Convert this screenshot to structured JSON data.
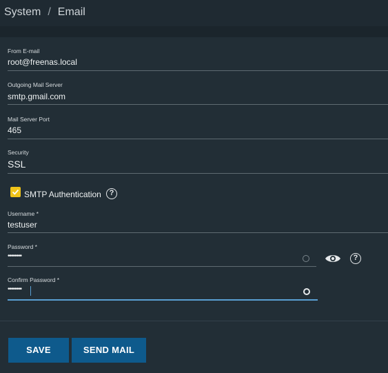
{
  "breadcrumb": {
    "parent": "System",
    "separator": "/",
    "current": "Email"
  },
  "fields": {
    "from_email": {
      "label": "From E-mail",
      "value": "root@freenas.local"
    },
    "outgoing_server": {
      "label": "Outgoing Mail Server",
      "value": "smtp.gmail.com"
    },
    "port": {
      "label": "Mail Server Port",
      "value": "465"
    },
    "security": {
      "label": "Security",
      "value": "SSL"
    },
    "smtp_auth": {
      "label": "SMTP Authentication",
      "checked": true,
      "help_icon": "help-circle-icon"
    },
    "username": {
      "label": "Username *",
      "value": "testuser"
    },
    "password": {
      "label": "Password *",
      "value": "••••••••",
      "visibility_icon": "eye-icon",
      "help_icon": "help-circle-icon"
    },
    "confirm_password": {
      "label": "Confirm Password *",
      "value": "••••••••"
    }
  },
  "buttons": {
    "save": "SAVE",
    "send_mail": "SEND MAIL"
  },
  "colors": {
    "accent": "#0e5a8c",
    "checkbox": "#f0c419",
    "focus": "#5aa0d4",
    "background": "#222e36"
  }
}
